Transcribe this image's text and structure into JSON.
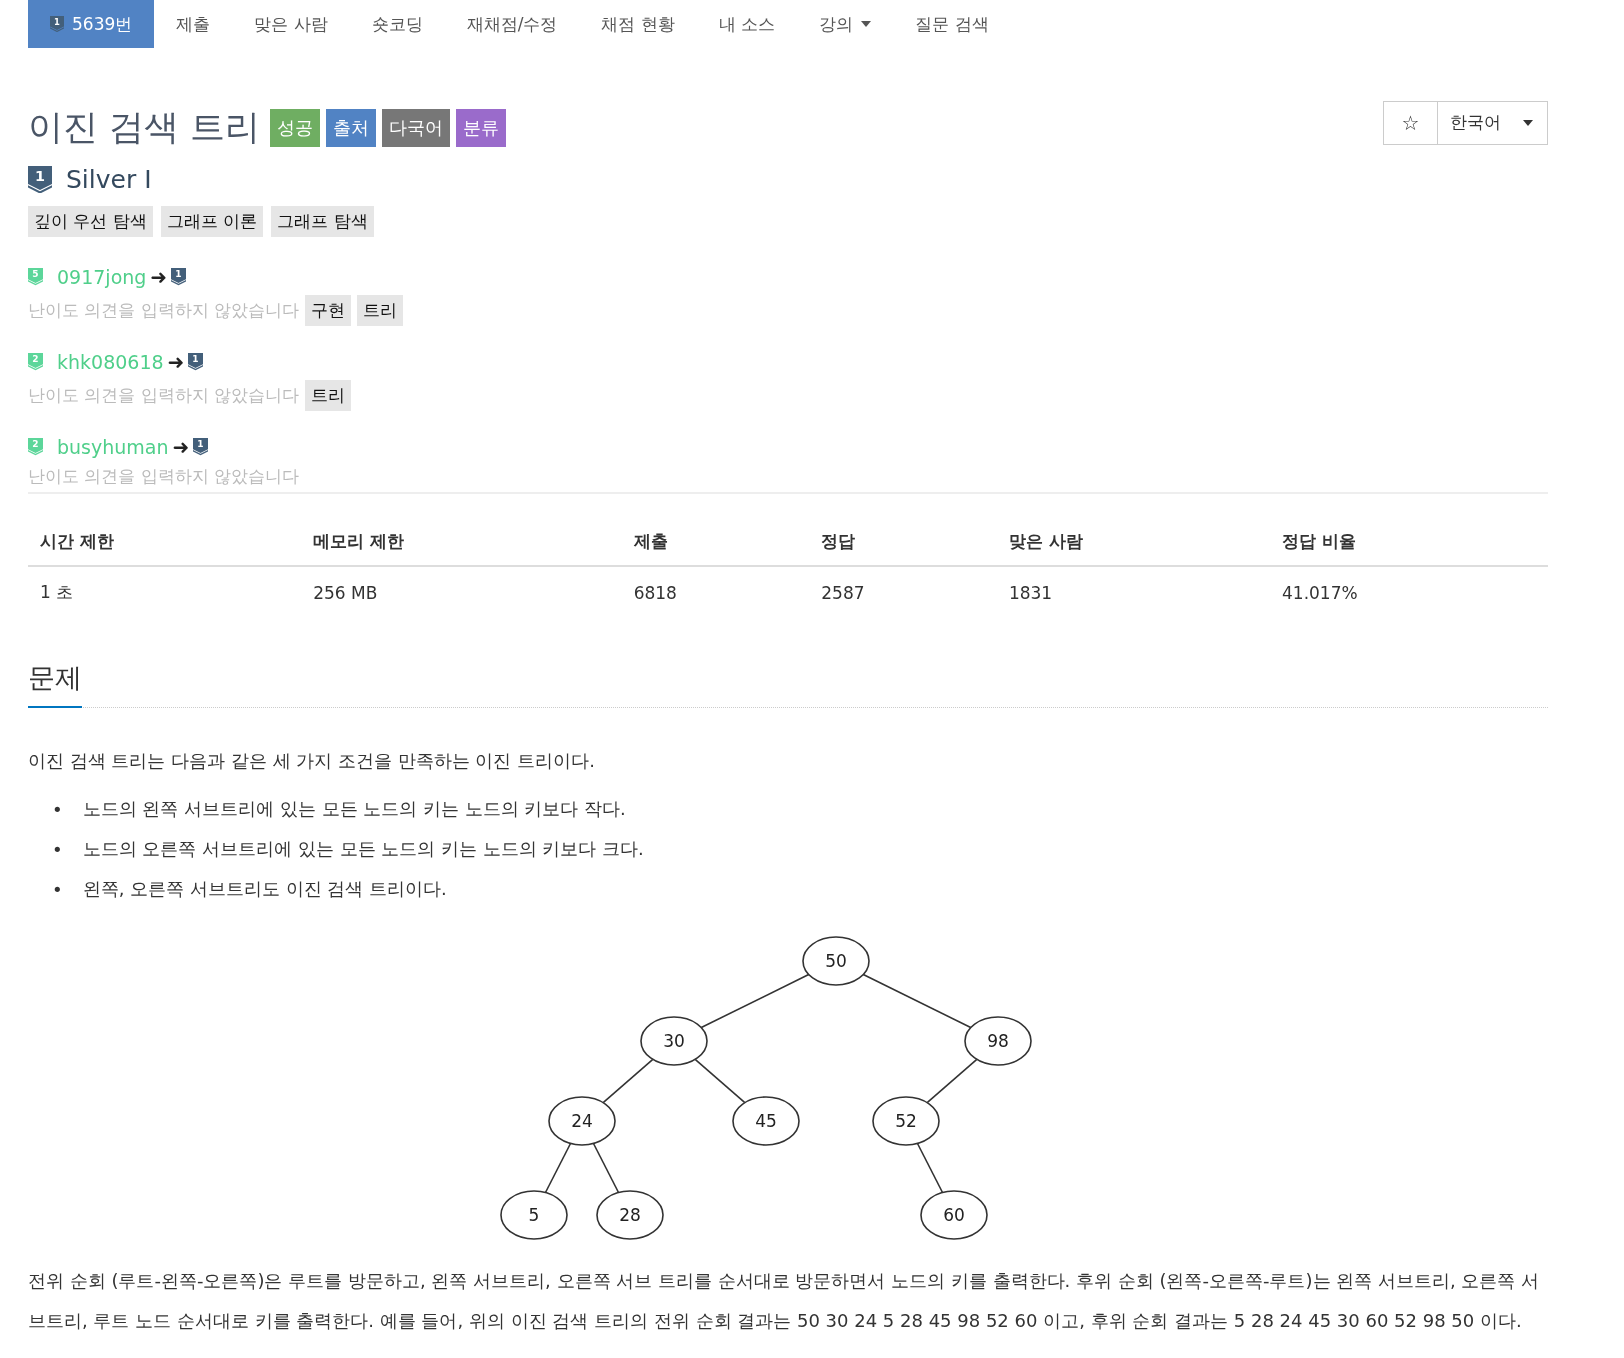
{
  "nav": {
    "problem_tier": "1",
    "items": [
      {
        "label": "5639번",
        "selected": true
      },
      {
        "label": "제출",
        "selected": false
      },
      {
        "label": "맞은 사람",
        "selected": false
      },
      {
        "label": "숏코딩",
        "selected": false
      },
      {
        "label": "재채점/수정",
        "selected": false
      },
      {
        "label": "채점 현황",
        "selected": false
      },
      {
        "label": "내 소스",
        "selected": false
      },
      {
        "label": "강의",
        "selected": false,
        "dropdown": true
      },
      {
        "label": "질문 검색",
        "selected": false
      }
    ]
  },
  "title": "이진 검색 트리",
  "labels": [
    {
      "label": "성공",
      "color": "#6fae62"
    },
    {
      "label": "출처",
      "color": "#5183c4"
    },
    {
      "label": "다국어",
      "color": "#777777"
    },
    {
      "label": "분류",
      "color": "#9a6bcb"
    }
  ],
  "star": "☆",
  "language": "한국어",
  "tier": {
    "icon": "1",
    "name": "Silver I"
  },
  "tags": [
    "깊이 우선 탐색",
    "그래프 이론",
    "그래프 탐색"
  ],
  "opinions": [
    {
      "from": "5",
      "user": "0917jong",
      "arrow": "➜",
      "to": "1",
      "note": "난이도 의견을 입력하지 않았습니다",
      "tags": [
        "구현",
        "트리"
      ]
    },
    {
      "from": "2",
      "user": "khk080618",
      "arrow": "➜",
      "to": "1",
      "note": "난이도 의견을 입력하지 않았습니다",
      "tags": [
        "트리"
      ]
    },
    {
      "from": "2",
      "user": "busyhuman",
      "arrow": "➜",
      "to": "1",
      "note": "난이도 의견을 입력하지 않았습니다"
    }
  ],
  "stats": {
    "columns": [
      "시간 제한",
      "메모리 제한",
      "제출",
      "정답",
      "맞은 사람",
      "정답 비율"
    ],
    "row": [
      "1 초",
      "256 MB",
      "6818",
      "2587",
      "1831",
      "41.017%"
    ]
  },
  "section": "문제",
  "intro": "이진 검색 트리는 다음과 같은 세 가지 조건을 만족하는 이진 트리이다.",
  "bullets": [
    {
      "marker": "•",
      "text": "노드의 왼쪽 서브트리에 있는 모든 노드의 키는 노드의 키보다 작다."
    },
    {
      "marker": "•",
      "text": "노드의 오른쪽 서브트리에 있는 모든 노드의 키는 노드의 키보다 크다."
    },
    {
      "marker": "•",
      "text": "왼쪽, 오른쪽 서브트리도 이진 검색 트리이다."
    }
  ],
  "tree": {
    "label": "50",
    "children": [
      {
        "label": "30",
        "kind": "left",
        "children": [
          {
            "label": "24",
            "kind": "left",
            "children": [
              {
                "label": "5",
                "kind": "left"
              },
              {
                "label": "28",
                "kind": "right"
              }
            ]
          },
          {
            "label": "45",
            "kind": "right"
          }
        ]
      },
      {
        "label": "98",
        "kind": "right",
        "children": [
          {
            "label": "52",
            "kind": "left",
            "children": [
              {
                "label": "60",
                "kind": "right"
              }
            ]
          }
        ]
      }
    ]
  },
  "paragraph": "전위 순회 (루트-왼쪽-오른쪽)은 루트를 방문하고, 왼쪽 서브트리, 오른쪽 서브 트리를 순서대로 방문하면서 노드의 키를 출력한다. 후위 순회 (왼쪽-오른쪽-루트)는 왼쪽 서브트리, 오른쪽 서브트리, 루트 노드 순서대로 키를 출력한다. 예를 들어, 위의 이진 검색 트리의 전위 순회 결과는 50 30 24 5 28 45 98 52 60 이고, 후위 순회 결과는 5 28 24 45 30 60 52 98 50 이다."
}
